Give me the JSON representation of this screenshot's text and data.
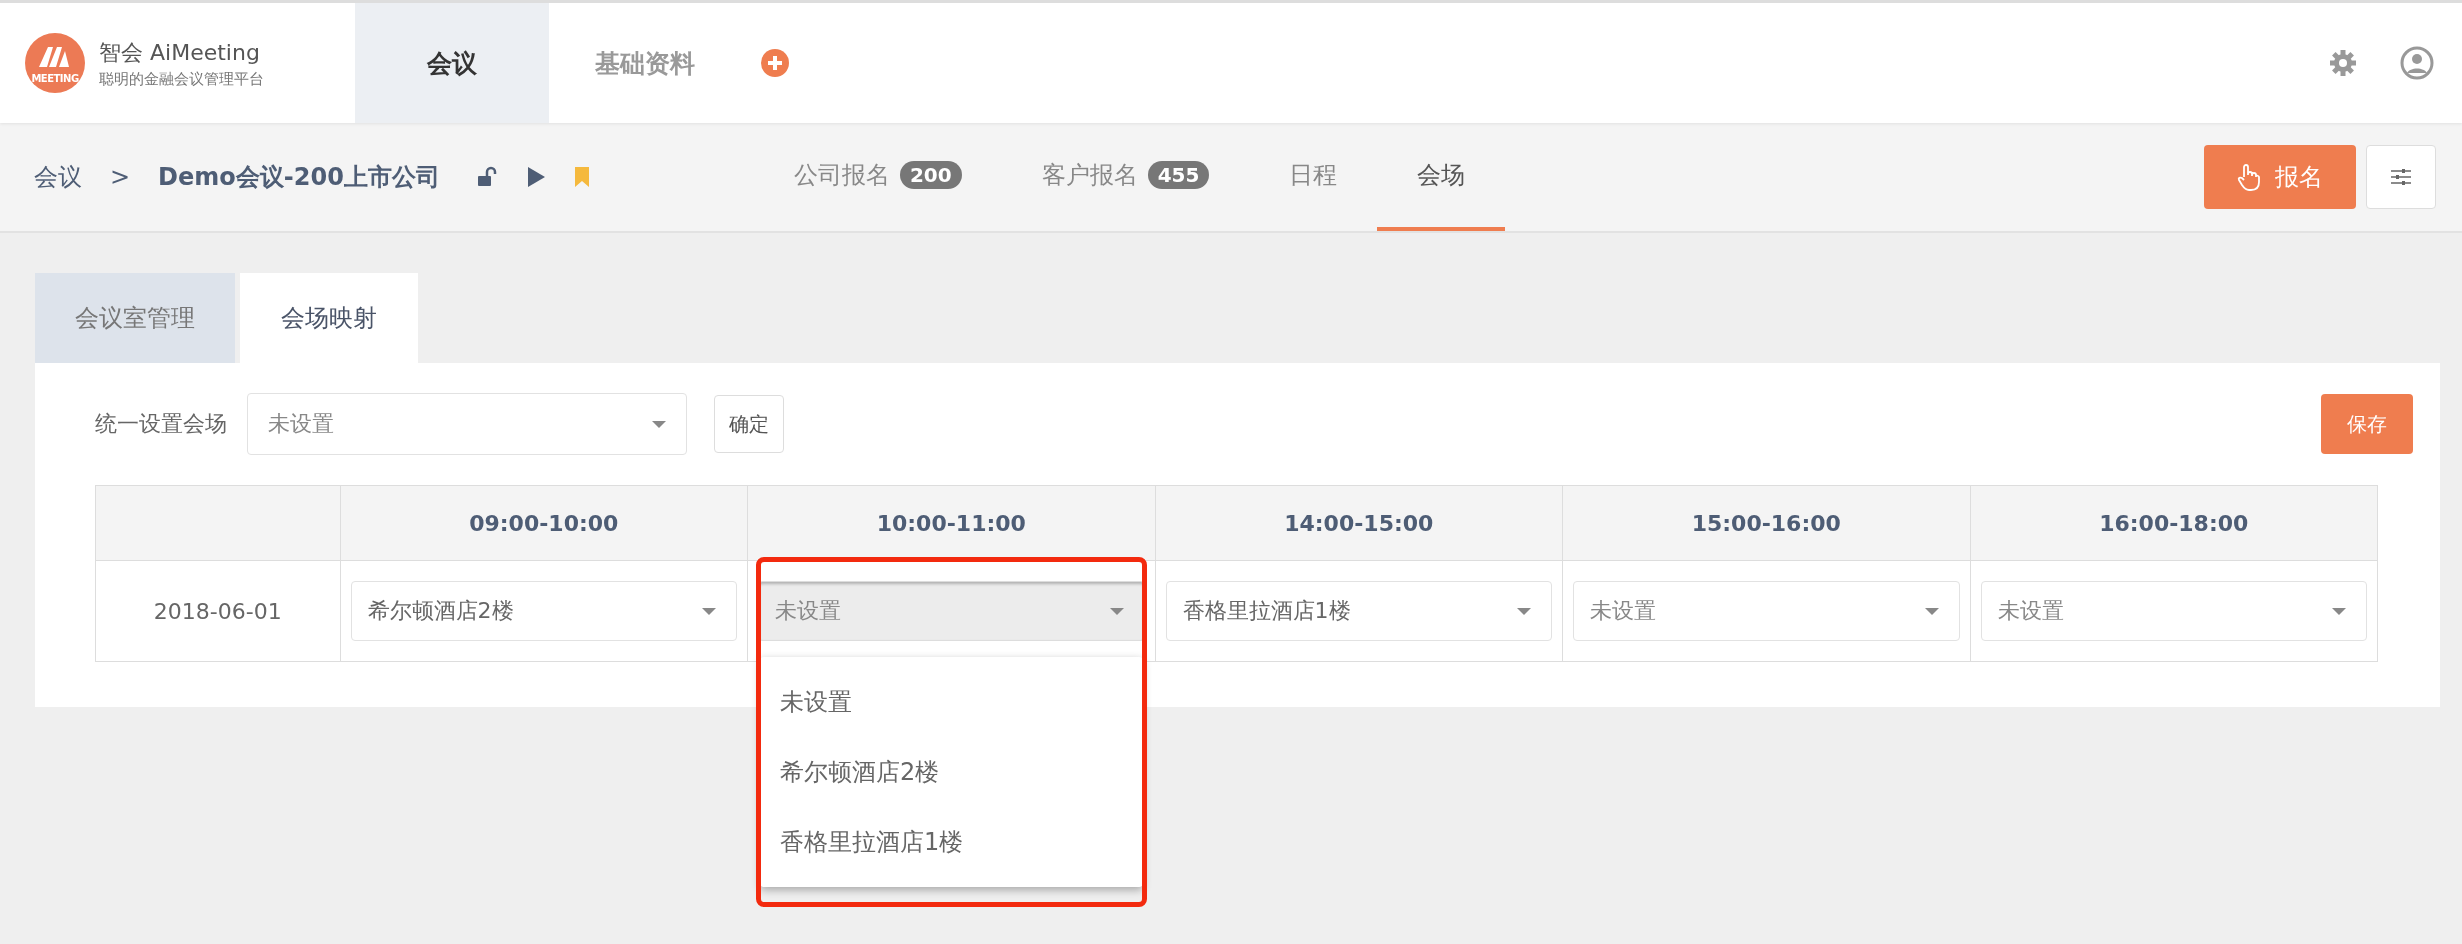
{
  "brand": {
    "name": "智会 AiMeeting",
    "tagline": "聪明的金融会议管理平台",
    "logo_text": "MEETING"
  },
  "top_tabs": [
    {
      "label": "会议",
      "selected": true
    },
    {
      "label": "基础资料",
      "selected": false
    }
  ],
  "breadcrumb": {
    "root": "会议",
    "separator": ">",
    "current": "Demo会议-200上市公司"
  },
  "sub_tabs": [
    {
      "label": "公司报名",
      "badge": "200",
      "selected": false
    },
    {
      "label": "客户报名",
      "badge": "455",
      "selected": false
    },
    {
      "label": "日程",
      "selected": false
    },
    {
      "label": "会场",
      "selected": true
    }
  ],
  "signup_button": "报名",
  "panel_tabs": [
    {
      "label": "会议室管理",
      "selected": false
    },
    {
      "label": "会场映射",
      "selected": true
    }
  ],
  "bulk": {
    "label": "统一设置会场",
    "value": "未设置",
    "confirm": "确定"
  },
  "save_button": "保存",
  "table": {
    "columns": [
      "09:00-10:00",
      "10:00-11:00",
      "14:00-15:00",
      "15:00-16:00",
      "16:00-18:00"
    ],
    "rows": [
      {
        "date": "2018-06-01",
        "cells": [
          {
            "value": "希尔顿酒店2楼",
            "set": true,
            "open": false
          },
          {
            "value": "未设置",
            "set": false,
            "open": true
          },
          {
            "value": "香格里拉酒店1楼",
            "set": true,
            "open": false
          },
          {
            "value": "未设置",
            "set": false,
            "open": false
          },
          {
            "value": "未设置",
            "set": false,
            "open": false
          }
        ]
      }
    ]
  },
  "dropdown_options": [
    "未设置",
    "希尔顿酒店2楼",
    "香格里拉酒店1楼"
  ]
}
